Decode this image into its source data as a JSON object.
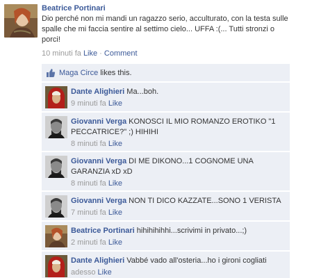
{
  "post": {
    "author": "Beatrice Portinari",
    "text": "Dio perché non mi mandi un ragazzo serio, acculturato, con la testa sulle spalle che mi faccia sentire al settimo cielo... UFFA :(... Tutti stronzi o porci!",
    "time": "10 minuti fa",
    "like_label": "Like",
    "separator": " · ",
    "comment_label": "Comment"
  },
  "likes": {
    "name": "Maga Circe",
    "text": " likes this."
  },
  "comments": [
    {
      "author": "Dante Alighieri",
      "text": " Ma...boh.",
      "time": "9 minuti fa",
      "like": "Like",
      "avatar": "dante"
    },
    {
      "author": "Giovanni Verga",
      "text": " KONOSCI IL MIO ROMANZO EROTIKO \"1 PECCATRICE?\" ;) HIHIHI",
      "time": "8 minuti fa",
      "like": "Like",
      "avatar": "verga"
    },
    {
      "author": "Giovanni Verga",
      "text": " DI ME DIKONO...1 COGNOME UNA GARANZIA xD xD",
      "time": "8 minuti fa",
      "like": "Like",
      "avatar": "verga"
    },
    {
      "author": "Giovanni Verga",
      "text": " NON TI DICO KAZZATE...SONO 1 VERISTA",
      "time": "7 minuti fa",
      "like": "Like",
      "avatar": "verga"
    },
    {
      "author": "Beatrice Portinari",
      "text": " hihihihihhi...scrivimi in privato...;)",
      "time": "2 minuti fa",
      "like": "Like",
      "avatar": "beatrice"
    },
    {
      "author": "Dante Alighieri",
      "text": " Vabbé vado all'osteria...ho i gironi cogliati",
      "time": "adesso",
      "like": "Like",
      "avatar": "dante"
    }
  ],
  "colors": {
    "link": "#3b5998",
    "panel": "#eceff5",
    "meta": "#999999"
  }
}
